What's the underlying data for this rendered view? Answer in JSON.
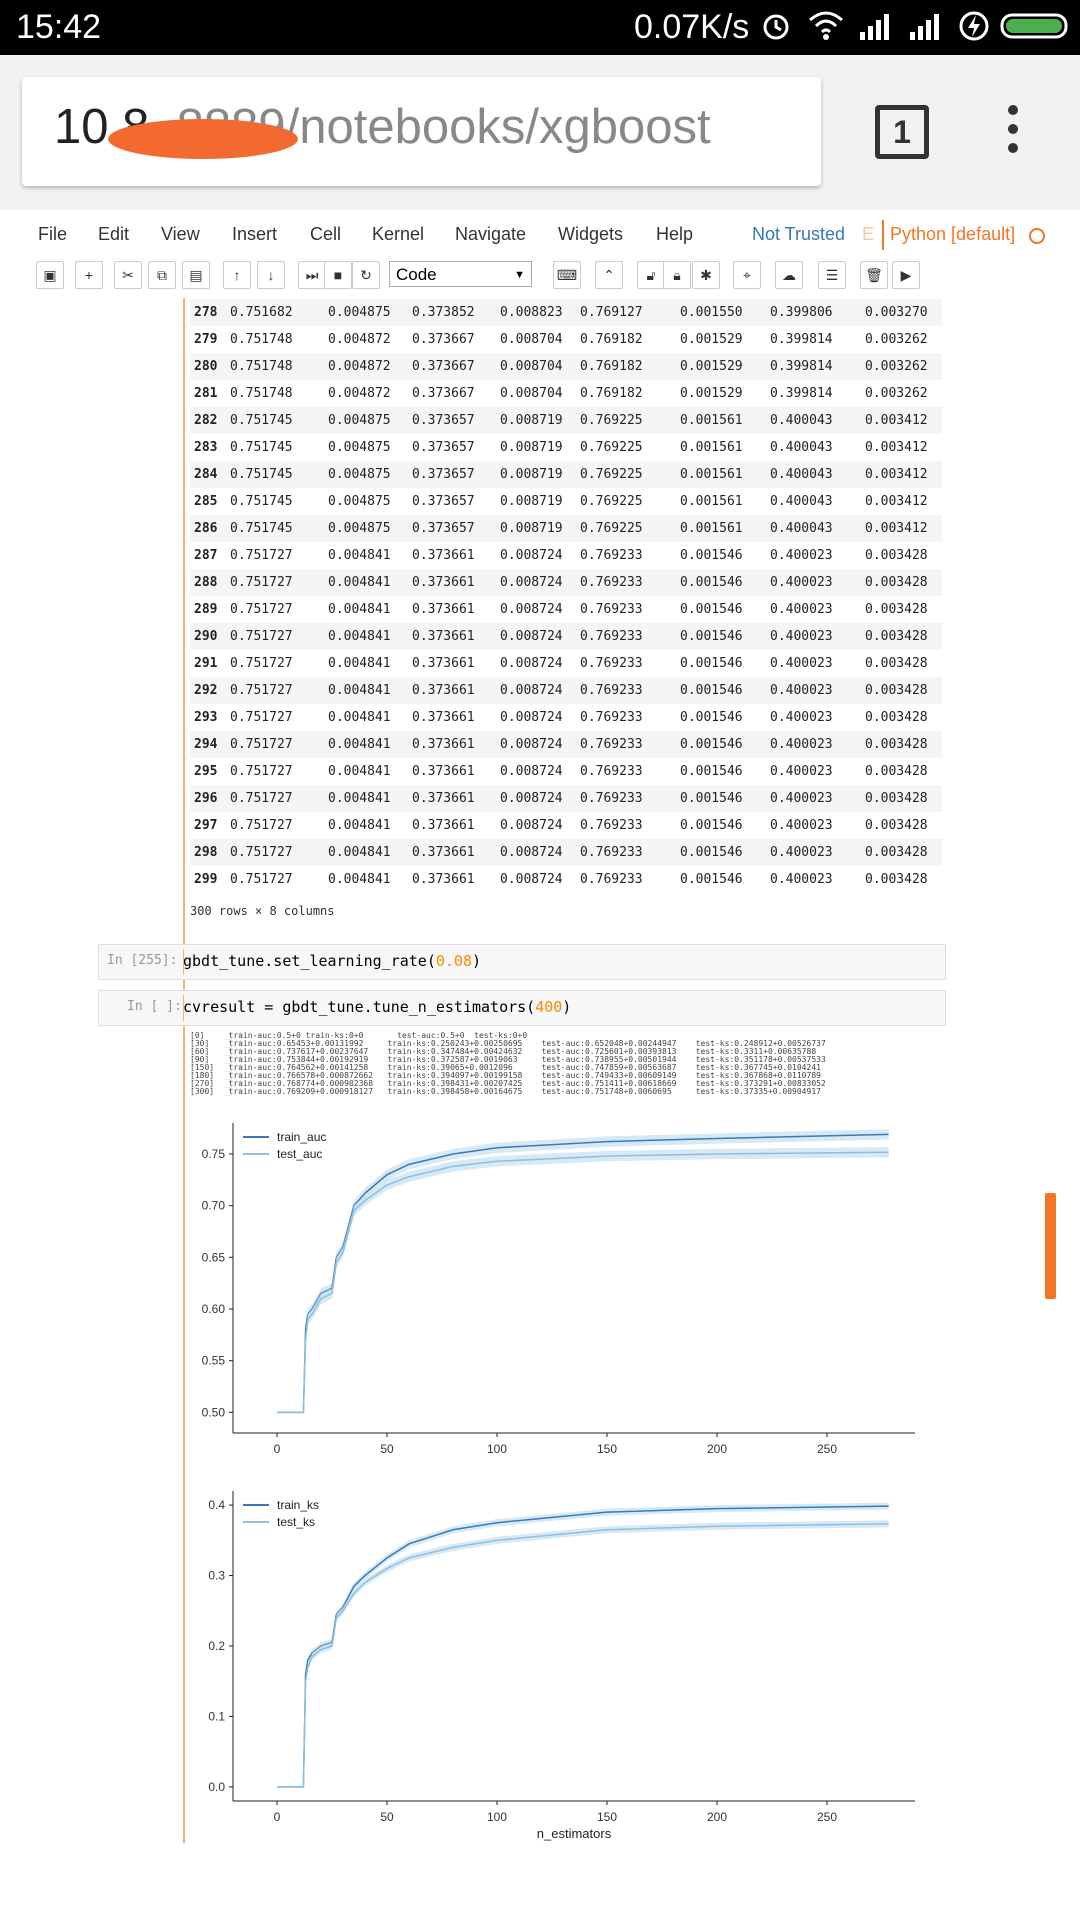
{
  "status_bar": {
    "time": "15:42",
    "net_speed": "0.07K/s"
  },
  "browser": {
    "url_host": "10.8",
    "url_rest": ".8889/notebooks/xgboost",
    "tab_count": "1"
  },
  "menubar": {
    "items": [
      "File",
      "Edit",
      "View",
      "Insert",
      "Cell",
      "Kernel",
      "Navigate",
      "Widgets",
      "Help"
    ],
    "not_trusted": "Not Trusted",
    "edit_indicator": "E",
    "kernel": "Python [default]"
  },
  "toolbar": {
    "cell_type": "Code"
  },
  "table": {
    "rows": [
      [
        "278",
        "0.751682",
        "0.004875",
        "0.373852",
        "0.008823",
        "0.769127",
        "0.001550",
        "0.399806",
        "0.003270"
      ],
      [
        "279",
        "0.751748",
        "0.004872",
        "0.373667",
        "0.008704",
        "0.769182",
        "0.001529",
        "0.399814",
        "0.003262"
      ],
      [
        "280",
        "0.751748",
        "0.004872",
        "0.373667",
        "0.008704",
        "0.769182",
        "0.001529",
        "0.399814",
        "0.003262"
      ],
      [
        "281",
        "0.751748",
        "0.004872",
        "0.373667",
        "0.008704",
        "0.769182",
        "0.001529",
        "0.399814",
        "0.003262"
      ],
      [
        "282",
        "0.751745",
        "0.004875",
        "0.373657",
        "0.008719",
        "0.769225",
        "0.001561",
        "0.400043",
        "0.003412"
      ],
      [
        "283",
        "0.751745",
        "0.004875",
        "0.373657",
        "0.008719",
        "0.769225",
        "0.001561",
        "0.400043",
        "0.003412"
      ],
      [
        "284",
        "0.751745",
        "0.004875",
        "0.373657",
        "0.008719",
        "0.769225",
        "0.001561",
        "0.400043",
        "0.003412"
      ],
      [
        "285",
        "0.751745",
        "0.004875",
        "0.373657",
        "0.008719",
        "0.769225",
        "0.001561",
        "0.400043",
        "0.003412"
      ],
      [
        "286",
        "0.751745",
        "0.004875",
        "0.373657",
        "0.008719",
        "0.769225",
        "0.001561",
        "0.400043",
        "0.003412"
      ],
      [
        "287",
        "0.751727",
        "0.004841",
        "0.373661",
        "0.008724",
        "0.769233",
        "0.001546",
        "0.400023",
        "0.003428"
      ],
      [
        "288",
        "0.751727",
        "0.004841",
        "0.373661",
        "0.008724",
        "0.769233",
        "0.001546",
        "0.400023",
        "0.003428"
      ],
      [
        "289",
        "0.751727",
        "0.004841",
        "0.373661",
        "0.008724",
        "0.769233",
        "0.001546",
        "0.400023",
        "0.003428"
      ],
      [
        "290",
        "0.751727",
        "0.004841",
        "0.373661",
        "0.008724",
        "0.769233",
        "0.001546",
        "0.400023",
        "0.003428"
      ],
      [
        "291",
        "0.751727",
        "0.004841",
        "0.373661",
        "0.008724",
        "0.769233",
        "0.001546",
        "0.400023",
        "0.003428"
      ],
      [
        "292",
        "0.751727",
        "0.004841",
        "0.373661",
        "0.008724",
        "0.769233",
        "0.001546",
        "0.400023",
        "0.003428"
      ],
      [
        "293",
        "0.751727",
        "0.004841",
        "0.373661",
        "0.008724",
        "0.769233",
        "0.001546",
        "0.400023",
        "0.003428"
      ],
      [
        "294",
        "0.751727",
        "0.004841",
        "0.373661",
        "0.008724",
        "0.769233",
        "0.001546",
        "0.400023",
        "0.003428"
      ],
      [
        "295",
        "0.751727",
        "0.004841",
        "0.373661",
        "0.008724",
        "0.769233",
        "0.001546",
        "0.400023",
        "0.003428"
      ],
      [
        "296",
        "0.751727",
        "0.004841",
        "0.373661",
        "0.008724",
        "0.769233",
        "0.001546",
        "0.400023",
        "0.003428"
      ],
      [
        "297",
        "0.751727",
        "0.004841",
        "0.373661",
        "0.008724",
        "0.769233",
        "0.001546",
        "0.400023",
        "0.003428"
      ],
      [
        "298",
        "0.751727",
        "0.004841",
        "0.373661",
        "0.008724",
        "0.769233",
        "0.001546",
        "0.400023",
        "0.003428"
      ],
      [
        "299",
        "0.751727",
        "0.004841",
        "0.373661",
        "0.008724",
        "0.769233",
        "0.001546",
        "0.400023",
        "0.003428"
      ]
    ],
    "rows_info": "300 rows × 8 columns"
  },
  "cells": [
    {
      "prompt": "In [255]:",
      "code_prefix": "gbdt_tune.set_learning_rate(",
      "code_arg": "0.08",
      "code_suffix": ")"
    },
    {
      "prompt": "In [ ]:",
      "code_prefix": "cvresult = gbdt_tune.tune_n_estimators(",
      "code_arg": "400",
      "code_suffix": ")"
    }
  ],
  "logs": [
    "[0]     train-auc:0.5+0 train-ks:0+0       test-auc:0.5+0  test-ks:0+0",
    "[30]    train-auc:0.65453+0.00131992     train-ks:0.250243+0.00250695    test-auc:0.652048+0.00244947    test-ks:0.248912+0.00526737",
    "[60]    train-auc:0.737617+0.00237647    train-ks:0.347484+0.00424632    test-auc:0.725601+0.00393813    test-ks:0.3311+0.00635788",
    "[90]    train-auc:0.753844+0.00192919    train-ks:0.372587+0.0019063     test-auc:0.738955+0.00501944    test-ks:0.351178+0.00537533",
    "[150]   train-auc:0.764562+0.00141258    train-ks:0.39065+0.0012096      test-auc:0.747859+0.00563687    test-ks:0.367745+0.0104241",
    "[180]   train-auc:0.766578+0.000872662   train-ks:0.394097+0.00199158    test-auc:0.749433+0.00609149    test-ks:0.367868+0.0110789",
    "[270]   train-auc:0.768774+0.000902368   train-ks:0.398431+0.00207425    test-auc:0.751411+0.00618669    test-ks:0.373291+0.00833052",
    "[300]   train-auc:0.769209+0.000918127   train-ks:0.398458+0.00164675    test-auc:0.751748+0.0060695     test-ks:0.37335+0.00904917"
  ],
  "colors": {
    "train": "#3a7ab8",
    "test": "#8fbfdf",
    "band": "#c6dff0",
    "accent": "#f37626",
    "link": "#337ab7"
  },
  "chart_data": [
    {
      "type": "line",
      "xlim": [
        -20,
        290
      ],
      "ylim": [
        0.48,
        0.78
      ],
      "xticks": [
        0,
        50,
        100,
        150,
        200,
        250
      ],
      "yticks": [
        0.5,
        0.55,
        0.6,
        0.65,
        0.7,
        0.75
      ],
      "xtick_labels": [
        "0",
        "50",
        "100",
        "150",
        "200",
        "250"
      ],
      "ytick_labels": [
        "0.50",
        "0.55",
        "0.60",
        "0.65",
        "0.70",
        "0.75"
      ],
      "xlabel": "",
      "grid": false,
      "legend": "top-left",
      "series": [
        {
          "name": "train_auc",
          "x": [
            0,
            12,
            13,
            14,
            16,
            20,
            25,
            27,
            30,
            35,
            40,
            50,
            60,
            80,
            100,
            150,
            200,
            278
          ],
          "y": [
            0.5,
            0.5,
            0.58,
            0.595,
            0.6,
            0.615,
            0.62,
            0.65,
            0.66,
            0.7,
            0.712,
            0.73,
            0.74,
            0.75,
            0.756,
            0.762,
            0.765,
            0.769
          ]
        },
        {
          "name": "test_auc",
          "x": [
            0,
            12,
            13,
            14,
            16,
            20,
            25,
            27,
            30,
            35,
            40,
            50,
            60,
            80,
            100,
            150,
            200,
            278
          ],
          "y": [
            0.5,
            0.5,
            0.57,
            0.59,
            0.595,
            0.61,
            0.615,
            0.645,
            0.655,
            0.695,
            0.705,
            0.72,
            0.728,
            0.738,
            0.743,
            0.748,
            0.75,
            0.7517
          ]
        }
      ]
    },
    {
      "type": "line",
      "xlim": [
        -20,
        290
      ],
      "ylim": [
        -0.02,
        0.42
      ],
      "xticks": [
        0,
        50,
        100,
        150,
        200,
        250
      ],
      "yticks": [
        0.0,
        0.1,
        0.2,
        0.3,
        0.4
      ],
      "xtick_labels": [
        "0",
        "50",
        "100",
        "150",
        "200",
        "250"
      ],
      "ytick_labels": [
        "0.0",
        "0.1",
        "0.2",
        "0.3",
        "0.4"
      ],
      "xlabel": "n_estimators",
      "grid": false,
      "legend": "top-left",
      "series": [
        {
          "name": "train_ks",
          "x": [
            0,
            12,
            13,
            14,
            16,
            20,
            25,
            27,
            30,
            35,
            40,
            50,
            60,
            80,
            100,
            150,
            200,
            278
          ],
          "y": [
            0.0,
            0.0,
            0.16,
            0.18,
            0.19,
            0.2,
            0.205,
            0.245,
            0.255,
            0.285,
            0.3,
            0.325,
            0.345,
            0.365,
            0.375,
            0.39,
            0.395,
            0.3985
          ]
        },
        {
          "name": "test_ks",
          "x": [
            0,
            12,
            13,
            14,
            16,
            20,
            25,
            27,
            30,
            35,
            40,
            50,
            60,
            80,
            100,
            150,
            200,
            278
          ],
          "y": [
            0.0,
            0.0,
            0.15,
            0.17,
            0.185,
            0.195,
            0.2,
            0.24,
            0.25,
            0.275,
            0.29,
            0.31,
            0.325,
            0.34,
            0.35,
            0.365,
            0.37,
            0.3734
          ]
        }
      ]
    }
  ]
}
